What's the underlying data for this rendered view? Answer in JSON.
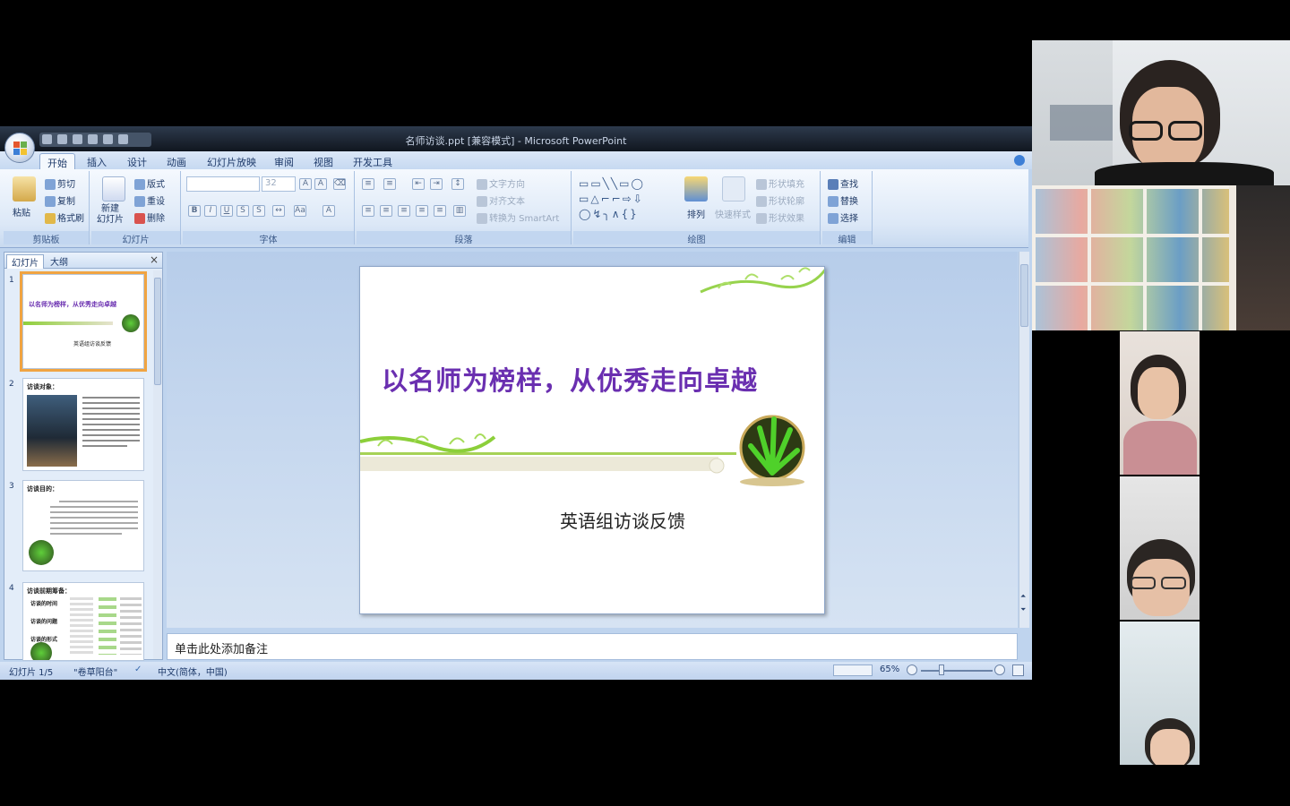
{
  "app": {
    "window_title": "名师访谈.ppt [兼容模式] - Microsoft PowerPoint"
  },
  "ribbon": {
    "tabs": [
      "开始",
      "插入",
      "设计",
      "动画",
      "幻灯片放映",
      "审阅",
      "视图",
      "开发工具"
    ],
    "active_tab": "开始",
    "groups": {
      "clipboard": {
        "label": "剪贴板",
        "paste": "粘贴",
        "cut": "剪切",
        "copy": "复制",
        "format_painter": "格式刷"
      },
      "slides": {
        "label": "幻灯片",
        "new_slide": "新建\n幻灯片",
        "layout": "版式",
        "reset": "重设",
        "delete": "删除"
      },
      "font": {
        "label": "字体",
        "font_size": "32",
        "font_name": ""
      },
      "paragraph": {
        "label": "段落",
        "text_direction": "文字方向",
        "align_text": "对齐文本",
        "smartart": "转换为 SmartArt"
      },
      "drawing": {
        "label": "绘图",
        "arrange": "排列",
        "quick_styles": "快速样式",
        "shape_fill": "形状填充",
        "shape_outline": "形状轮廓",
        "shape_effects": "形状效果"
      },
      "editing": {
        "label": "编辑",
        "find": "查找",
        "replace": "替换",
        "select": "选择"
      }
    }
  },
  "slide_pane": {
    "tabs": [
      "幻灯片",
      "大纲"
    ],
    "active_tab": "幻灯片",
    "thumbnails": [
      {
        "number": "1",
        "title": "以名师为榜样，从优秀走向卓越",
        "subtitle": "英语组访谈反馈",
        "selected": true
      },
      {
        "number": "2",
        "title": "访谈对象：",
        "selected": false
      },
      {
        "number": "3",
        "title": "访谈目的：",
        "selected": false
      },
      {
        "number": "4",
        "title": "访谈前期筹备：",
        "items": [
          "访谈的时间",
          "访谈的问题",
          "访谈的形式"
        ],
        "selected": false
      }
    ]
  },
  "slide": {
    "title": "以名师为榜样，从优秀走向卓越",
    "subtitle": "英语组访谈反馈"
  },
  "notes": {
    "placeholder": "单击此处添加备注"
  },
  "status_bar": {
    "slide_counter": "幻灯片 1/5",
    "theme": "\"卷草阳台\"",
    "language": "中文(简体，中国)",
    "zoom": "65%"
  },
  "colors": {
    "title_purple": "#6a2fb0",
    "ribbon_blue": "#c6d9f1",
    "selection_orange": "#f0a442"
  }
}
